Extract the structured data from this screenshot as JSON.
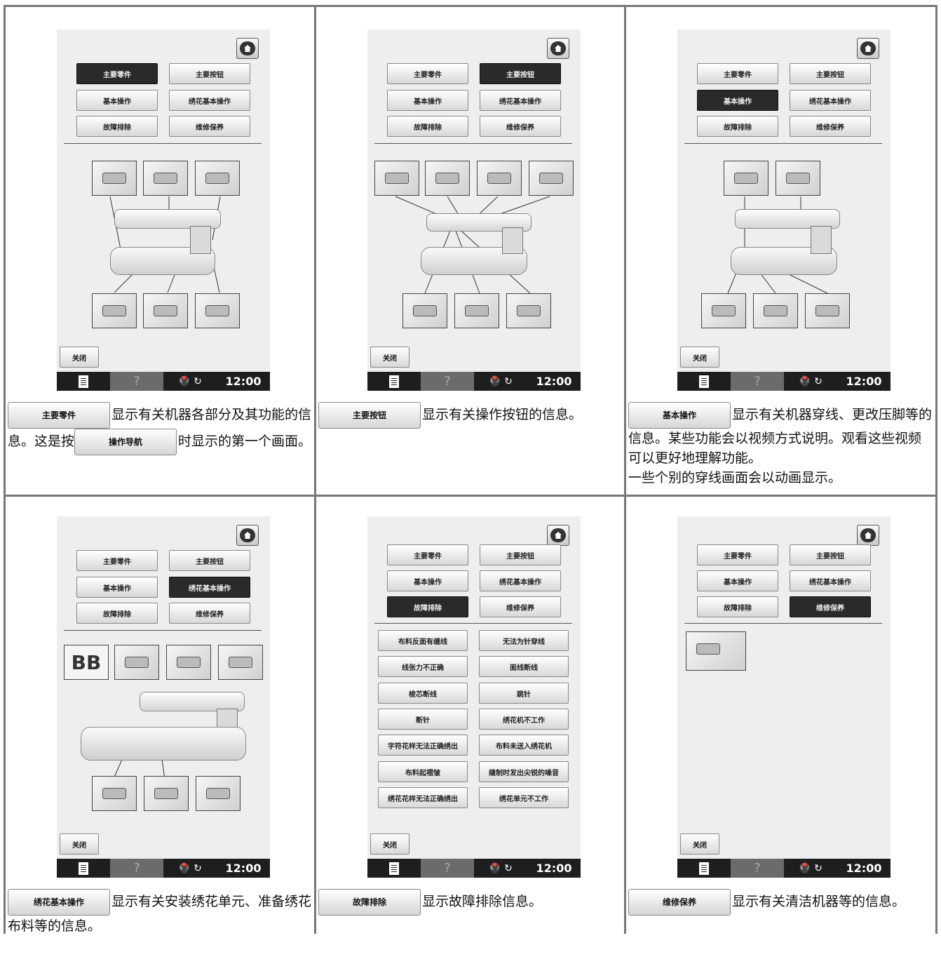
{
  "screen": {
    "close_label": "关闭",
    "help_glyph": "?",
    "status_symbols": "🖲️ ↻",
    "time": "12:00",
    "menu": {
      "main_parts": "主要零件",
      "main_buttons": "主要按钮",
      "basic_operation": "基本操作",
      "embroidery_basic": "绣花基本操作",
      "troubleshooting": "故障排除",
      "maintenance": "维修保养"
    }
  },
  "troubleshooting_list": [
    "布料反面有缠线",
    "无法为针穿线",
    "线张力不正确",
    "面线断线",
    "梭芯断线",
    "跳针",
    "断针",
    "绣花机不工作",
    "字符花样无法正确绣出",
    "布料未送入绣花机",
    "布料起褶皱",
    "缝制时发出尖锐的噪音",
    "绣花花样无法正确绣出",
    "绣花单元不工作"
  ],
  "embroidery_thumb_text": "BB",
  "descriptions": {
    "cell1_button": "主要零件",
    "cell1_text_a": "显示有关机器各部分及其功能的信息。这是按",
    "cell1_inline_button": "操作导航",
    "cell1_text_b": "时显示的第一个画面。",
    "cell2_button": "主要按钮",
    "cell2_text": "显示有关操作按钮的信息。",
    "cell3_button": "基本操作",
    "cell3_text": "显示有关机器穿线、更改压脚等的信息。某些功能会以视频方式说明。观看这些视频可以更好地理解功能。",
    "cell3_text2": "一些个别的穿线画面会以动画显示。",
    "cell4_button": "绣花基本操作",
    "cell4_text": "显示有关安装绣花单元、准备绣花布料等的信息。",
    "cell5_button": "故障排除",
    "cell5_text": "显示故障排除信息。",
    "cell6_button": "维修保养",
    "cell6_text": "显示有关清洁机器等的信息。"
  }
}
